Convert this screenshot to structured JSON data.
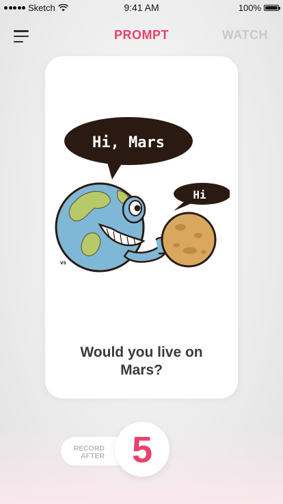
{
  "status_bar": {
    "carrier": "Sketch",
    "time": "9:41 AM",
    "battery": "100%",
    "battery_level": 1.0
  },
  "nav": {
    "prompt_tab": "PROMPT",
    "watch_tab": "WATCH",
    "menu_icon": "hamburger-menu-icon"
  },
  "card": {
    "illustration": {
      "speech_bubble_1": "Hi, Mars",
      "speech_bubble_2": "Hi",
      "signature": "VS"
    },
    "question": "Would you live on Mars?"
  },
  "record": {
    "label_line1": "RECORD",
    "label_line2": "AFTER",
    "countdown": "5"
  },
  "colors": {
    "accent": "#e8426f",
    "inactive_tab": "#c9c9c9",
    "question_text": "#3a3a3a",
    "bubble": "#2a1a12",
    "earth_ocean": "#7fb8d6",
    "earth_land": "#b8c96a",
    "mars": "#d9a85f"
  }
}
